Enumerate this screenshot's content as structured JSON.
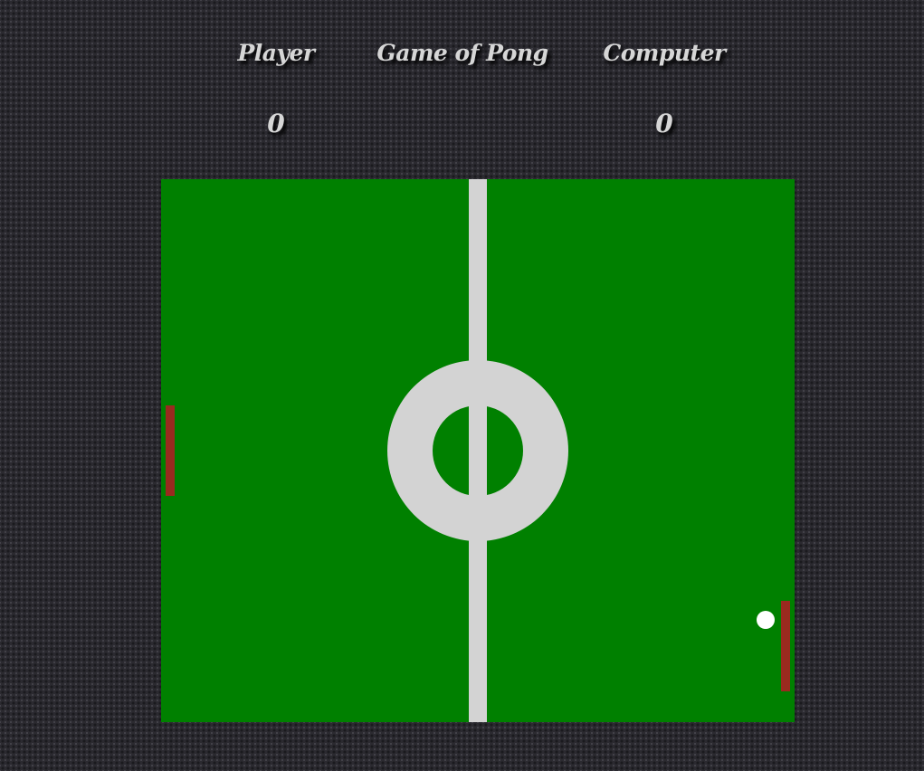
{
  "header": {
    "player_label": "Player",
    "title": "Game of Pong",
    "computer_label": "Computer"
  },
  "scores": {
    "player": "0",
    "computer": "0"
  },
  "colors": {
    "background": "#2b2a30",
    "court": "#008000",
    "court_lines": "#d3d3d3",
    "paddle": "#9a2a1f",
    "ball": "#ffffff",
    "text": "#d6d6d6"
  }
}
